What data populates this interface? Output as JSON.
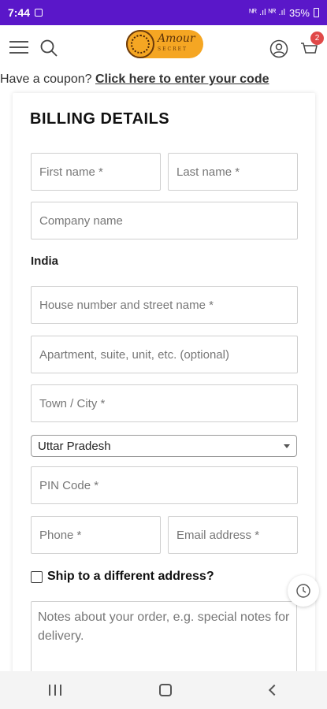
{
  "status_bar": {
    "time": "7:44",
    "battery": "35%",
    "signal_text": "ᴺᴿ .ıl ᴺᴿ .ıl"
  },
  "header": {
    "logo_text": "Amour",
    "logo_subtext": "SECRET",
    "cart_count": "2"
  },
  "coupon": {
    "prompt": "Have a coupon? ",
    "link": "Click here to enter your code"
  },
  "billing": {
    "title": "BILLING DETAILS",
    "first_name_placeholder": "First name *",
    "last_name_placeholder": "Last name *",
    "company_placeholder": "Company name",
    "country_value": "India",
    "street_placeholder": "House number and street name *",
    "apartment_placeholder": "Apartment, suite, unit, etc. (optional)",
    "city_placeholder": "Town / City *",
    "state_value": "Uttar Pradesh",
    "pin_placeholder": "PIN Code *",
    "phone_placeholder": "Phone *",
    "email_placeholder": "Email address *",
    "ship_different_label": "Ship to a different address?",
    "notes_placeholder": "Notes about your order, e.g. special notes for delivery."
  },
  "colors": {
    "status_bar": "#5a17c9",
    "logo_bg": "#f5a623",
    "badge": "#e04848"
  },
  "icons": [
    "menu-icon",
    "search-icon",
    "user-icon",
    "cart-icon",
    "history-icon",
    "recent-apps-icon",
    "home-icon",
    "back-icon"
  ]
}
